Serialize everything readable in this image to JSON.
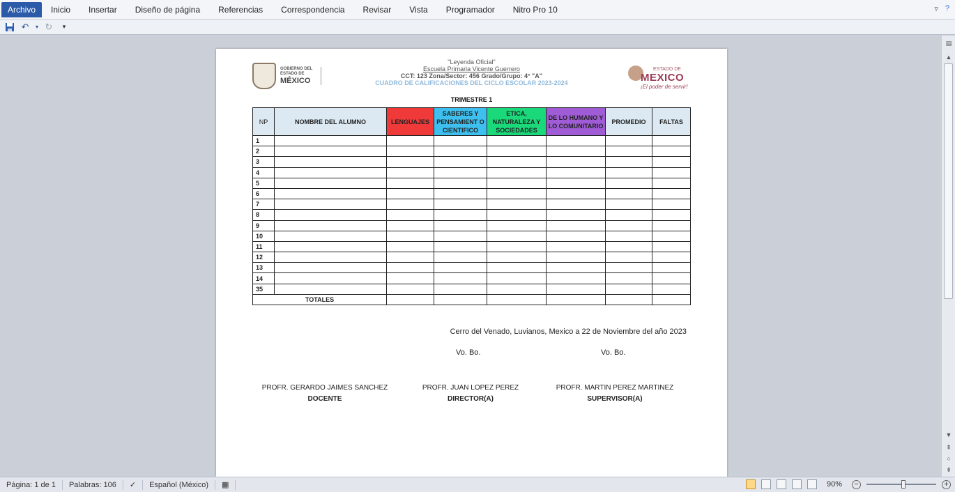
{
  "ribbon": {
    "tabs": [
      "Archivo",
      "Inicio",
      "Insertar",
      "Diseño de página",
      "Referencias",
      "Correspondencia",
      "Revisar",
      "Vista",
      "Programador",
      "Nitro Pro 10"
    ]
  },
  "quick_access": {
    "save": "save-icon",
    "undo": "undo-icon",
    "redo": "redo-icon",
    "customize": "dropdown-icon"
  },
  "document": {
    "logo_left": {
      "line1": "GOBIERNO DEL",
      "line2": "ESTADO DE",
      "line3": "MÉXICO"
    },
    "logo_right": {
      "estado": "ESTADO DE",
      "mexico": "MEXICO",
      "slogan": "¡El poder de servir!"
    },
    "leyenda": "\"Leyenda Oficial\"",
    "school": "Escuela Primaria Vicente Guerrero",
    "cct": "CCT: 123 Zona/Sector: 456 Grado/Grupo: 4° \"A\"",
    "cuadro": "CUADRO DE CALIFICACIONES DEL CICLO ESCOLAR 2023-2024",
    "trimestre": "TRIMESTRE 1",
    "table": {
      "headers": {
        "np": "NP",
        "name": "NOMBRE DEL ALUMNO",
        "lenguajes": "LENGUAJES",
        "saberes": "SABERES Y PENSAMIENT O CIENTIFICO",
        "etica": "ETICA, NATURALEZA Y SOCIEDADES",
        "humano": "DE LO HUMANO Y LO COMUNITARIO",
        "promedio": "PROMEDIO",
        "faltas": "FALTAS"
      },
      "header_colors": {
        "lenguajes": "#f03a3a",
        "saberes": "#3dc0f0",
        "etica": "#1ad97a",
        "humano": "#a05cd6",
        "neutral": "#dce9f2"
      },
      "rows": [
        "1",
        "2",
        "3",
        "4",
        "5",
        "6",
        "7",
        "8",
        "9",
        "10",
        "11",
        "12",
        "13",
        "14",
        "35"
      ],
      "totales": "TOTALES"
    },
    "fecha": "Cerro del Venado, Luvianos, Mexico a  22 de Noviembre del año 2023",
    "vobo1": "Vo. Bo.",
    "vobo2": "Vo. Bo.",
    "signatures": [
      {
        "name": "PROFR. GERARDO JAIMES SANCHEZ",
        "role": "DOCENTE"
      },
      {
        "name": "PROFR. JUAN LOPEZ PEREZ",
        "role": "DIRECTOR(A)"
      },
      {
        "name": "PROFR. MARTIN PEREZ MARTINEZ",
        "role": "SUPERVISOR(A)"
      }
    ]
  },
  "status": {
    "page": "Página: 1 de 1",
    "words": "Palabras: 106",
    "language": "Español (México)",
    "zoom": "90%"
  }
}
